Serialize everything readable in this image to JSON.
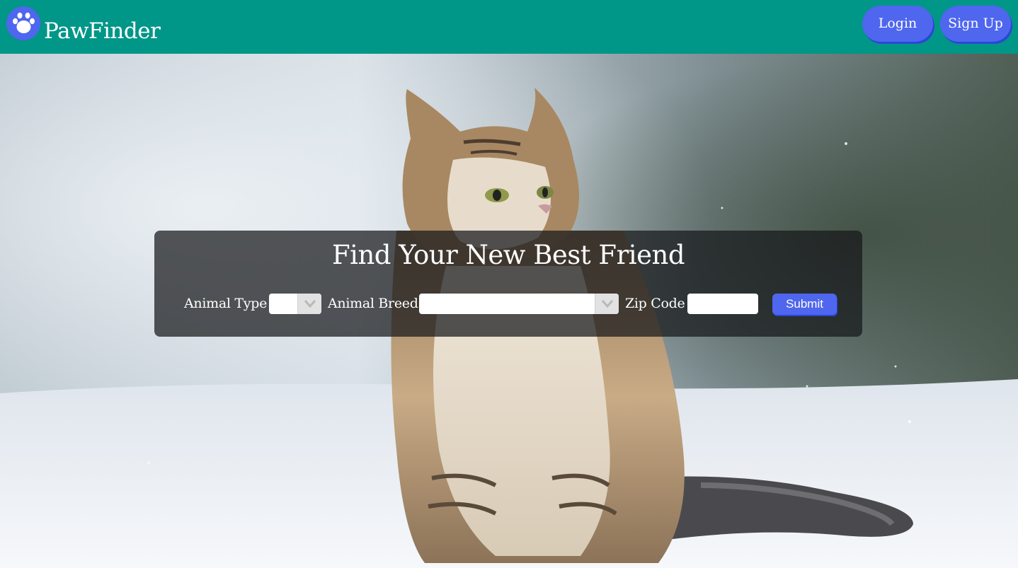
{
  "header": {
    "brand": "PawFinder",
    "logo_icon": "paw-icon",
    "login_label": "Login",
    "signup_label": "Sign Up"
  },
  "hero": {
    "background_image": "cat-in-snow-photo"
  },
  "search": {
    "title": "Find Your New Best Friend",
    "animal_type_label": "Animal Type",
    "animal_type_value": "",
    "animal_breed_label": "Animal Breed",
    "animal_breed_value": "",
    "zip_label": "Zip Code",
    "zip_value": "",
    "submit_label": "Submit"
  },
  "colors": {
    "navbar": "#009688",
    "button": "#4f66ee",
    "button_shadow": "#2c46d6",
    "panel": "rgba(22,24,26,0.72)",
    "text_light": "#ffffff"
  }
}
